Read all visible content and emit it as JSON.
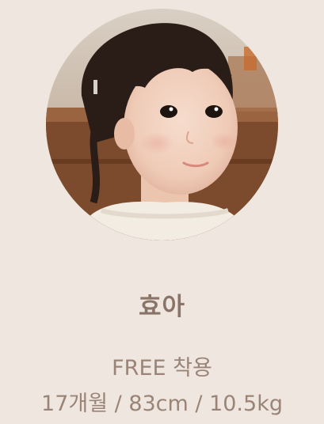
{
  "model": {
    "name": "효아",
    "size_text": "FREE 착용",
    "spec_text": "17개월 / 83cm / 10.5kg"
  },
  "colors": {
    "background": "#efe7df",
    "text": "#9a8478",
    "name_text": "#8a7467"
  }
}
